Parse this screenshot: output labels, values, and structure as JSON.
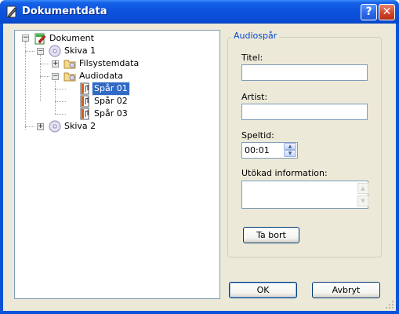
{
  "window": {
    "title": "Dokumentdata",
    "help_label": "?",
    "close_label": "✕"
  },
  "tree": {
    "root": "Dokument",
    "disc1": "Skiva 1",
    "filesystem": "Filsystemdata",
    "audiodata": "Audiodata",
    "tracks": [
      "Spår 01",
      "Spår 02",
      "Spår 03"
    ],
    "disc2": "Skiva 2",
    "selected": "Spår 01"
  },
  "group": {
    "title": "Audiospår",
    "title_label": "Titel:",
    "title_value": "",
    "artist_label": "Artist:",
    "artist_value": "",
    "duration_label": "Speltid:",
    "duration_value": "00:01",
    "extended_label": "Utökad information:",
    "extended_value": "",
    "remove_button": "Ta bort"
  },
  "buttons": {
    "ok": "OK",
    "cancel": "Avbryt"
  },
  "colors": {
    "title_bar": "#0a4fd6",
    "selection": "#316ac5",
    "group_title": "#0046d5",
    "dialog_bg": "#ece9d8"
  }
}
